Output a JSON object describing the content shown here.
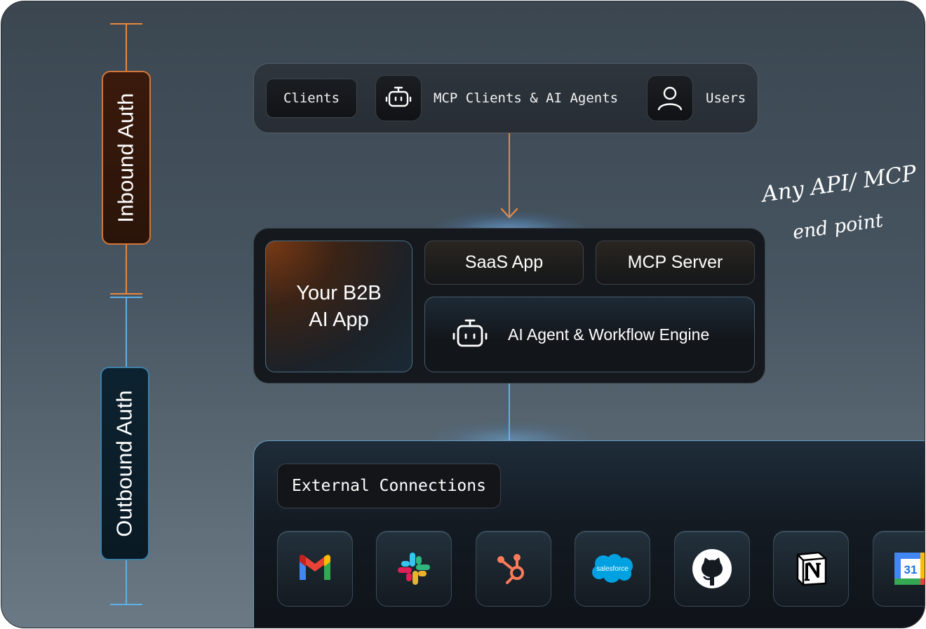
{
  "auth": {
    "inbound_label": "Inbound Auth",
    "outbound_label": "Outbound Auth"
  },
  "top_bar": {
    "clients_label": "Clients",
    "mcp_clients_label": "MCP Clients & AI Agents",
    "users_label": "Users"
  },
  "annotation": {
    "line1": "Any API/ MCP",
    "line2": "end point"
  },
  "core": {
    "b2b_line1": "Your B2B",
    "b2b_line2": "AI App",
    "saas_label": "SaaS App",
    "mcp_server_label": "MCP Server",
    "engine_label": "AI Agent & Workflow Engine"
  },
  "external": {
    "title": "External Connections",
    "apps": [
      {
        "icon": "gmail-icon"
      },
      {
        "icon": "slack-icon"
      },
      {
        "icon": "hubspot-icon"
      },
      {
        "icon": "salesforce-icon",
        "text": "salesforce"
      },
      {
        "icon": "github-icon"
      },
      {
        "icon": "notion-icon"
      },
      {
        "icon": "google-calendar-icon",
        "text": "31"
      }
    ]
  },
  "colors": {
    "inbound": "#e8873f",
    "outbound": "#5fb0e6"
  }
}
